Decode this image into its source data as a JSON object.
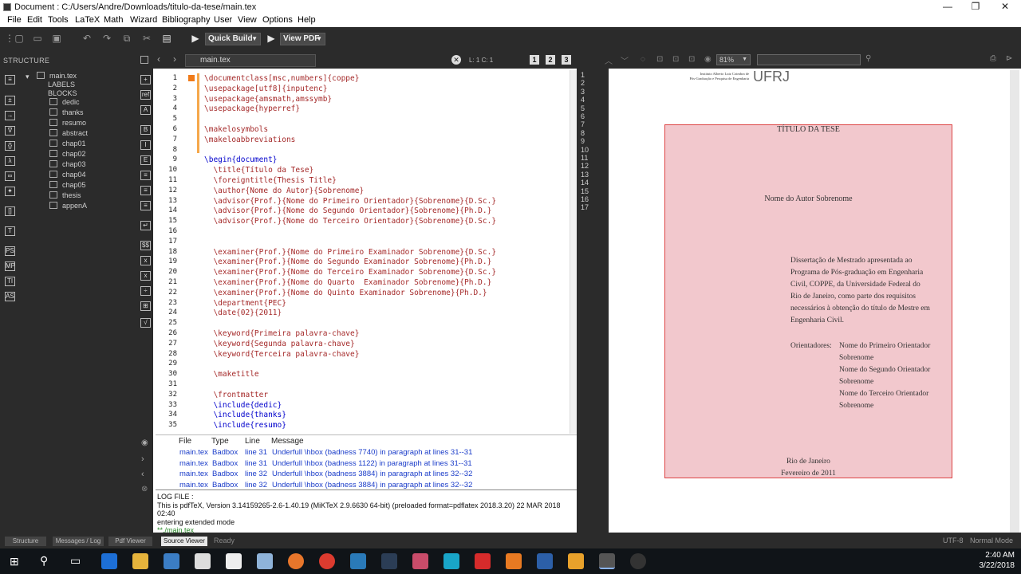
{
  "window": {
    "title": "Document : C:/Users/Andre/Downloads/titulo-da-tese/main.tex",
    "minimize": "—",
    "maximize": "❐",
    "close": "✕"
  },
  "menu": [
    "File",
    "Edit",
    "Tools",
    "LaTeX",
    "Math",
    "Wizard",
    "Bibliography",
    "User",
    "View",
    "Options",
    "Help"
  ],
  "toolbar": {
    "quick_build": "Quick Build",
    "view_pdf": "View PDF"
  },
  "structure": {
    "title": "STRUCTURE",
    "root": "main.tex",
    "labels": "LABELS",
    "blocks": "BLOCKS",
    "items": [
      "dedic",
      "thanks",
      "resumo",
      "abstract",
      "chap01",
      "chap02",
      "chap03",
      "chap04",
      "chap05",
      "thesis",
      "appenA"
    ]
  },
  "editor_tab": {
    "file": "main.tex",
    "cursor": "L: 1 C: 1",
    "v1": "1",
    "v2": "2",
    "v3": "3"
  },
  "code_lines": [
    "\\documentclass[msc,numbers]{coppe}",
    "\\usepackage[utf8]{inputenc}",
    "\\usepackage{amsmath,amssymb}",
    "\\usepackage{hyperref}",
    "",
    "\\makelosymbols",
    "\\makeloabbreviations",
    "",
    "\\begin{document}",
    "  \\title{Título da Tese}",
    "  \\foreigntitle{Thesis Title}",
    "  \\author{Nome do Autor}{Sobrenome}",
    "  \\advisor{Prof.}{Nome do Primeiro Orientador}{Sobrenome}{D.Sc.}",
    "  \\advisor{Prof.}{Nome do Segundo Orientador}{Sobrenome}{Ph.D.}",
    "  \\advisor{Prof.}{Nome do Terceiro Orientador}{Sobrenome}{D.Sc.}",
    "",
    "",
    "  \\examiner{Prof.}{Nome do Primeiro Examinador Sobrenome}{D.Sc.}",
    "  \\examiner{Prof.}{Nome do Segundo Examinador Sobrenome}{Ph.D.}",
    "  \\examiner{Prof.}{Nome do Terceiro Examinador Sobrenome}{D.Sc.}",
    "  \\examiner{Prof.}{Nome do Quarto  Examinador Sobrenome}{Ph.D.}",
    "  \\examiner{Prof.}{Nome do Quinto Examinador Sobrenome}{Ph.D.}",
    "  \\department{PEC}",
    "  \\date{02}{2011}",
    "",
    "  \\keyword{Primeira palavra-chave}",
    "  \\keyword{Segunda palavra-chave}",
    "  \\keyword{Terceira palavra-chave}",
    "",
    "  \\maketitle",
    "",
    "  \\frontmatter",
    "  \\include{dedic}",
    "  \\include{thanks}",
    "  \\include{resumo}"
  ],
  "messages": {
    "headers": [
      "File",
      "Type",
      "Line",
      "Message"
    ],
    "rows": [
      [
        "main.tex",
        "Badbox",
        "line 31",
        "Underfull \\hbox (badness 7740) in paragraph at lines 31--31"
      ],
      [
        "main.tex",
        "Badbox",
        "line 31",
        "Underfull \\hbox (badness 1122) in paragraph at lines 31--31"
      ],
      [
        "main.tex",
        "Badbox",
        "line 32",
        "Underfull \\hbox (badness 3884) in paragraph at lines 32--32"
      ],
      [
        "main.tex",
        "Badbox",
        "line 32",
        "Underfull \\hbox (badness 3884) in paragraph at lines 32--32"
      ]
    ]
  },
  "log": {
    "l1": "LOG FILE :",
    "l2": "This is pdfTeX, Version 3.14159265-2.6-1.40.19 (MiKTeX 2.9.6630 64-bit) (preloaded format=pdflatex 2018.3.20) 22 MAR 2018",
    "l3": "02:40",
    "l4": "entering extended mode",
    "l5": "**./main.tex"
  },
  "pdf": {
    "zoom": "81%",
    "lines": [
      "1",
      "2",
      "3",
      "4",
      "5",
      "6",
      "7",
      "8",
      "9",
      "10",
      "11",
      "12",
      "13",
      "14",
      "15",
      "16",
      "17"
    ],
    "inst1": "Instituto Alberto Luiz Coimbra de",
    "inst2": "Pós-Graduação e Pesquisa de Engenharia",
    "logo": "UFRJ",
    "titulo": "TÍTULO DA TESE",
    "autor": "Nome do Autor Sobrenome",
    "diss": [
      "Dissertação de Mestrado apresentada ao",
      "Programa de Pós-graduação em Engenharia",
      "Civil, COPPE, da Universidade Federal do",
      "Rio de Janeiro, como parte dos requisitos",
      "necessários à obtenção do título de Mestre em",
      "Engenharia Civil."
    ],
    "orient_label": "Orientadores:",
    "orient": [
      "Nome do Primeiro Orientador",
      "Sobrenome",
      "Nome do Segundo Orientador",
      "Sobrenome",
      "Nome do Terceiro Orientador",
      "Sobrenome"
    ],
    "city": "Rio de Janeiro",
    "date": "Fevereiro de 2011"
  },
  "status": {
    "tabs": [
      "Structure",
      "Messages / Log",
      "Pdf Viewer",
      "Source Viewer"
    ],
    "ready": "Ready",
    "encoding": "UTF-8",
    "mode": "Normal Mode"
  },
  "clock": {
    "time": "2:40 AM",
    "date": "3/22/2018"
  }
}
